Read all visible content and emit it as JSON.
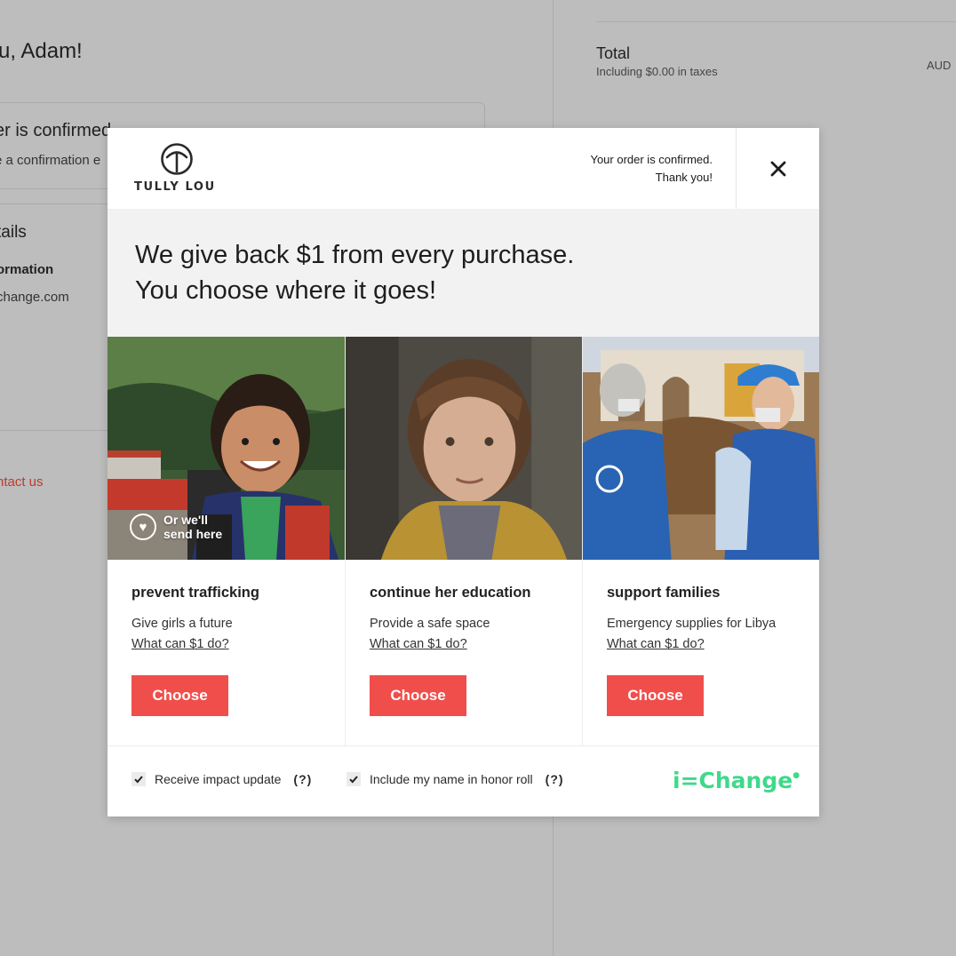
{
  "background": {
    "greeting": "u, Adam!",
    "order_confirmed": "er is confirmed",
    "confirmation_sub": "e a confirmation e",
    "details_heading": "tails",
    "information_label": "ormation",
    "email_fragment": "change.com",
    "contact_link": "ntact us",
    "total_label": "Total",
    "taxes_text": "Including $0.00 in taxes",
    "currency": "AUD"
  },
  "modal": {
    "logo_text": "TULLY LOU",
    "confirm_line1": "Your order is confirmed.",
    "confirm_line2": "Thank you!",
    "headline_line1": "We give back $1 from every purchase.",
    "headline_line2": "You choose where it goes!",
    "send_here_line1": "Or we'll",
    "send_here_line2": "send here",
    "cards": [
      {
        "title": "prevent trafficking",
        "description": "Give girls a future",
        "link": "What can $1 do?",
        "button": "Choose"
      },
      {
        "title": "continue her education",
        "description": "Provide a safe space",
        "link": "What can $1 do?",
        "button": "Choose"
      },
      {
        "title": "support families",
        "description": "Emergency supplies for Libya",
        "link": "What can $1 do?",
        "button": "Choose"
      }
    ],
    "footer": {
      "option1": "Receive impact update",
      "option2": "Include my name in honor roll",
      "help": "(?)",
      "brand": "i=Change"
    }
  },
  "colors": {
    "accent": "#f04e4b",
    "brand_green": "#3fd98a",
    "overlay": "#bdbdbd"
  }
}
